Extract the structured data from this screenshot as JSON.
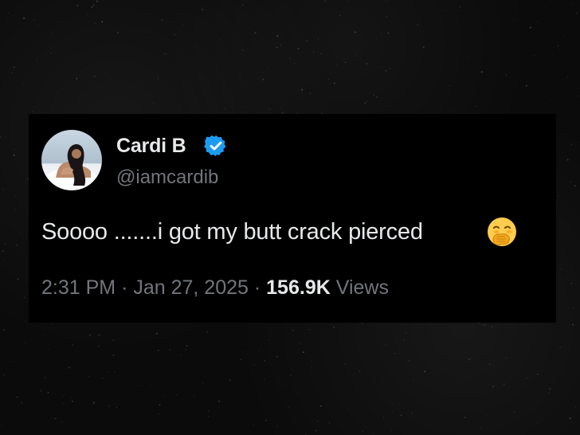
{
  "tweet": {
    "display_name": "Cardi B",
    "handle": "@iamcardib",
    "verified": true,
    "text": "Soooo .......i got my butt crack pierced",
    "emoji": "face-with-hand-over-mouth",
    "time": "2:31 PM",
    "separator": "·",
    "date": "Jan 27, 2025",
    "views_count": "156.9K",
    "views_label": "Views"
  },
  "colors": {
    "background": "#0b0b0b",
    "card": "#000000",
    "primary_text": "#e7e9ea",
    "secondary_text": "#71767b",
    "verified_badge": "#1d9bf0",
    "emoji": "#ffcc4d"
  }
}
